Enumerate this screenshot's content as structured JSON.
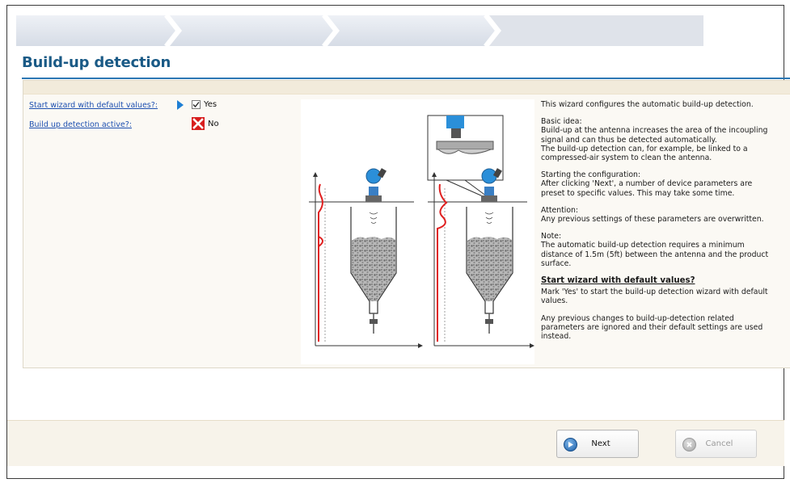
{
  "page": {
    "title": "Build-up detection"
  },
  "parameters": [
    {
      "label": "Start wizard with default values?:",
      "value": "Yes",
      "control": "checkbox-checked"
    },
    {
      "label": "Build up detection active?:",
      "value": "No",
      "control": "red-x"
    }
  ],
  "help": {
    "intro": "This wizard configures the automatic build-up detection.",
    "basic_idea": "Basic idea:\nBuild-up at the antenna increases the area of the incoupling signal and can thus be detected automatically.\nThe build-up detection can, for example, be linked to a compressed-air system to clean the antenna.",
    "starting": "Starting the configuration:\nAfter clicking 'Next', a number of device parameters are preset to specific values. This may take some time.",
    "attention": "Attention:\nAny previous settings of these parameters are overwritten.",
    "note": "Note:\nThe automatic build-up detection requires a minimum distance of 1.5m (5ft) between the antenna and the product surface.",
    "heading": "Start wizard with default values?",
    "mark_yes": "Mark 'Yes' to start the build-up detection wizard with default values.",
    "previous_changes": "Any previous changes to build-up-detection related parameters are ignored and their default settings are used instead."
  },
  "buttons": {
    "next": "Next",
    "cancel": "Cancel"
  },
  "icons": {
    "marker": "current-selection-arrow-icon",
    "checkbox": "checkmark-icon",
    "no": "red-x-icon",
    "next": "play-circle-icon",
    "cancel": "close-circle-icon"
  },
  "colors": {
    "title": "#1a5a86",
    "link": "#1c4fb0",
    "no_icon": "#d81e1e",
    "marker": "#1e7fd4"
  }
}
